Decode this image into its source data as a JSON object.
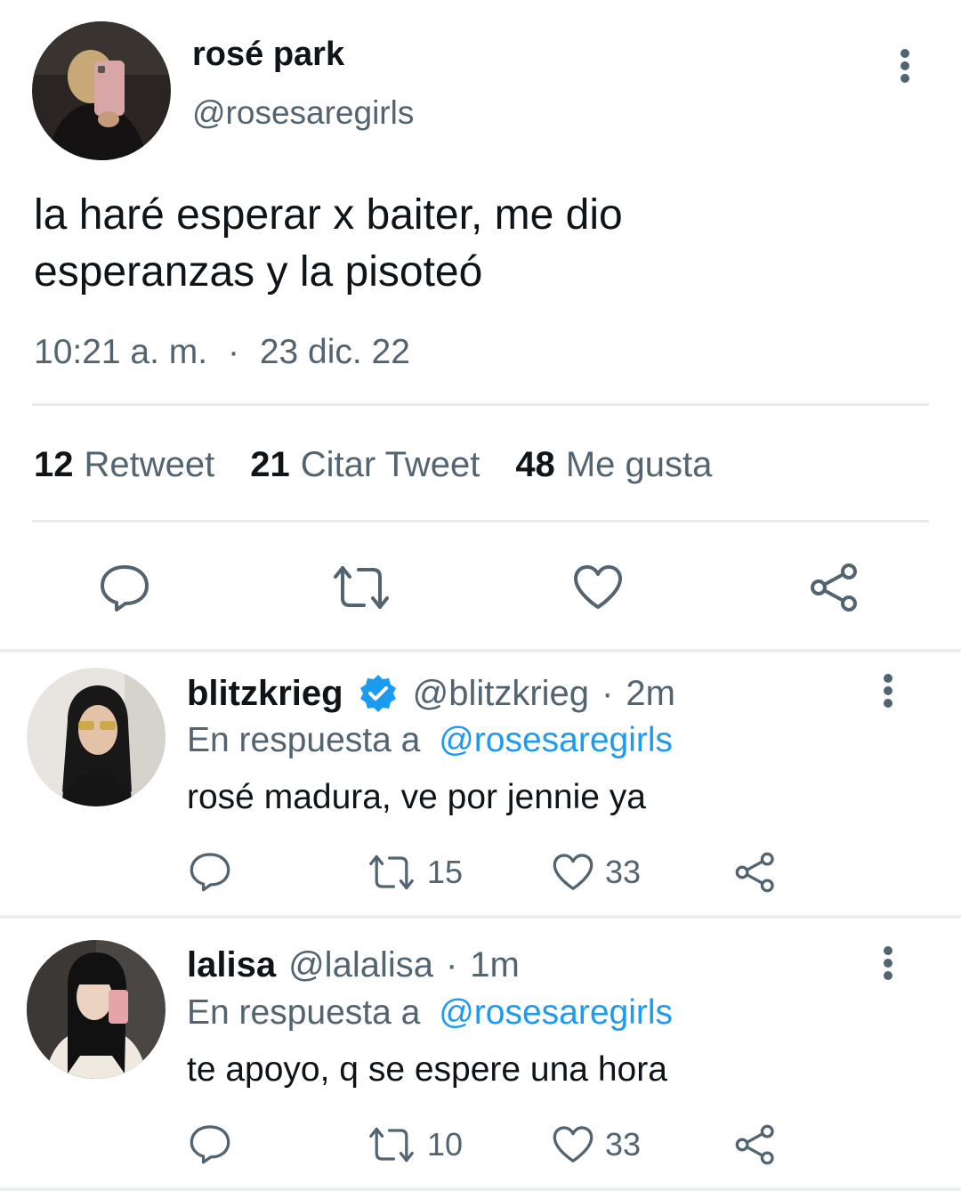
{
  "tweet": {
    "author_name": "rosé park",
    "author_handle": "@rosesaregirls",
    "text_line1": "la haré esperar x baiter, me dio",
    "text_line2": "esperanzas y la pisoteó",
    "time": "10:21 a. m.",
    "separator": "·",
    "date": "23 dic. 22",
    "stats": {
      "retweets": "12",
      "retweets_label": "Retweet",
      "quotes": "21",
      "quotes_label": "Citar Tweet",
      "likes": "48",
      "likes_label": "Me gusta"
    },
    "actions": [
      "reply-icon",
      "retweet-icon",
      "like-icon",
      "share-icon"
    ]
  },
  "replies": [
    {
      "name": "blitzkrieg",
      "verified": true,
      "handle": "@blitzkrieg",
      "separator": "·",
      "time": "2m",
      "reply_to_label": "En respuesta a",
      "reply_to_handle": "@rosesaregirls",
      "text": "rosé madura, ve por jennie ya",
      "retweets": "15",
      "likes": "33"
    },
    {
      "name": "lalisa",
      "verified": false,
      "handle": "@lalalisa",
      "separator": "·",
      "time": "1m",
      "reply_to_label": "En respuesta a",
      "reply_to_handle": "@rosesaregirls",
      "text": "te apoyo, q se espere una hora",
      "retweets": "10",
      "likes": "33"
    }
  ],
  "colors": {
    "text": "#0f1419",
    "secondary": "#536471",
    "link": "#1d9bf0",
    "verified": "#1d9bf0"
  }
}
